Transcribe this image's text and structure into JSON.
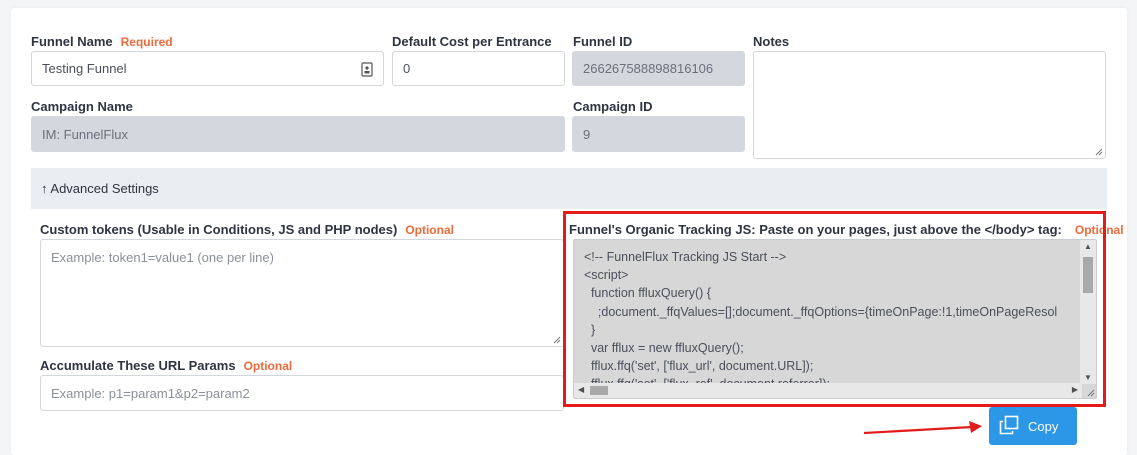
{
  "form": {
    "funnel_name": {
      "label": "Funnel Name",
      "badge": "Required",
      "value": "Testing Funnel"
    },
    "default_cost": {
      "label": "Default Cost per Entrance",
      "value": "0"
    },
    "funnel_id": {
      "label": "Funnel ID",
      "value": "266267588898816106"
    },
    "notes": {
      "label": "Notes",
      "value": ""
    },
    "campaign_name": {
      "label": "Campaign Name",
      "value": "IM: FunnelFlux"
    },
    "campaign_id": {
      "label": "Campaign ID",
      "value": "9"
    }
  },
  "advanced": {
    "toggle_label": "↑ Advanced Settings",
    "custom_tokens": {
      "label": "Custom tokens (Usable in Conditions, JS and PHP nodes)",
      "badge": "Optional",
      "placeholder": "Example: token1=value1 (one per line)"
    },
    "url_params": {
      "label": "Accumulate These URL Params",
      "badge": "Optional",
      "placeholder": "Example: p1=param1&p2=param2"
    },
    "tracking_js": {
      "label": "Funnel's Organic Tracking JS: Paste on your pages, just above the </body> tag:",
      "badge": "Optional",
      "code_lines": [
        "<!-- FunnelFlux Tracking JS Start -->",
        "<script>",
        "  function ffluxQuery() {",
        "    ;document._ffqValues=[];document._ffqOptions={timeOnPage:!1,timeOnPageResol",
        "  }",
        "  var fflux = new ffluxQuery();",
        "  fflux.ffq('set', ['flux_url', document.URL]);",
        "  fflux.ffq('set', ['flux_ref', document.referrer]);"
      ]
    }
  },
  "actions": {
    "copy_label": "Copy"
  },
  "colors": {
    "accent": "#2c97e7",
    "highlight": "#e31b1b",
    "badge": "#ef6a3b"
  }
}
